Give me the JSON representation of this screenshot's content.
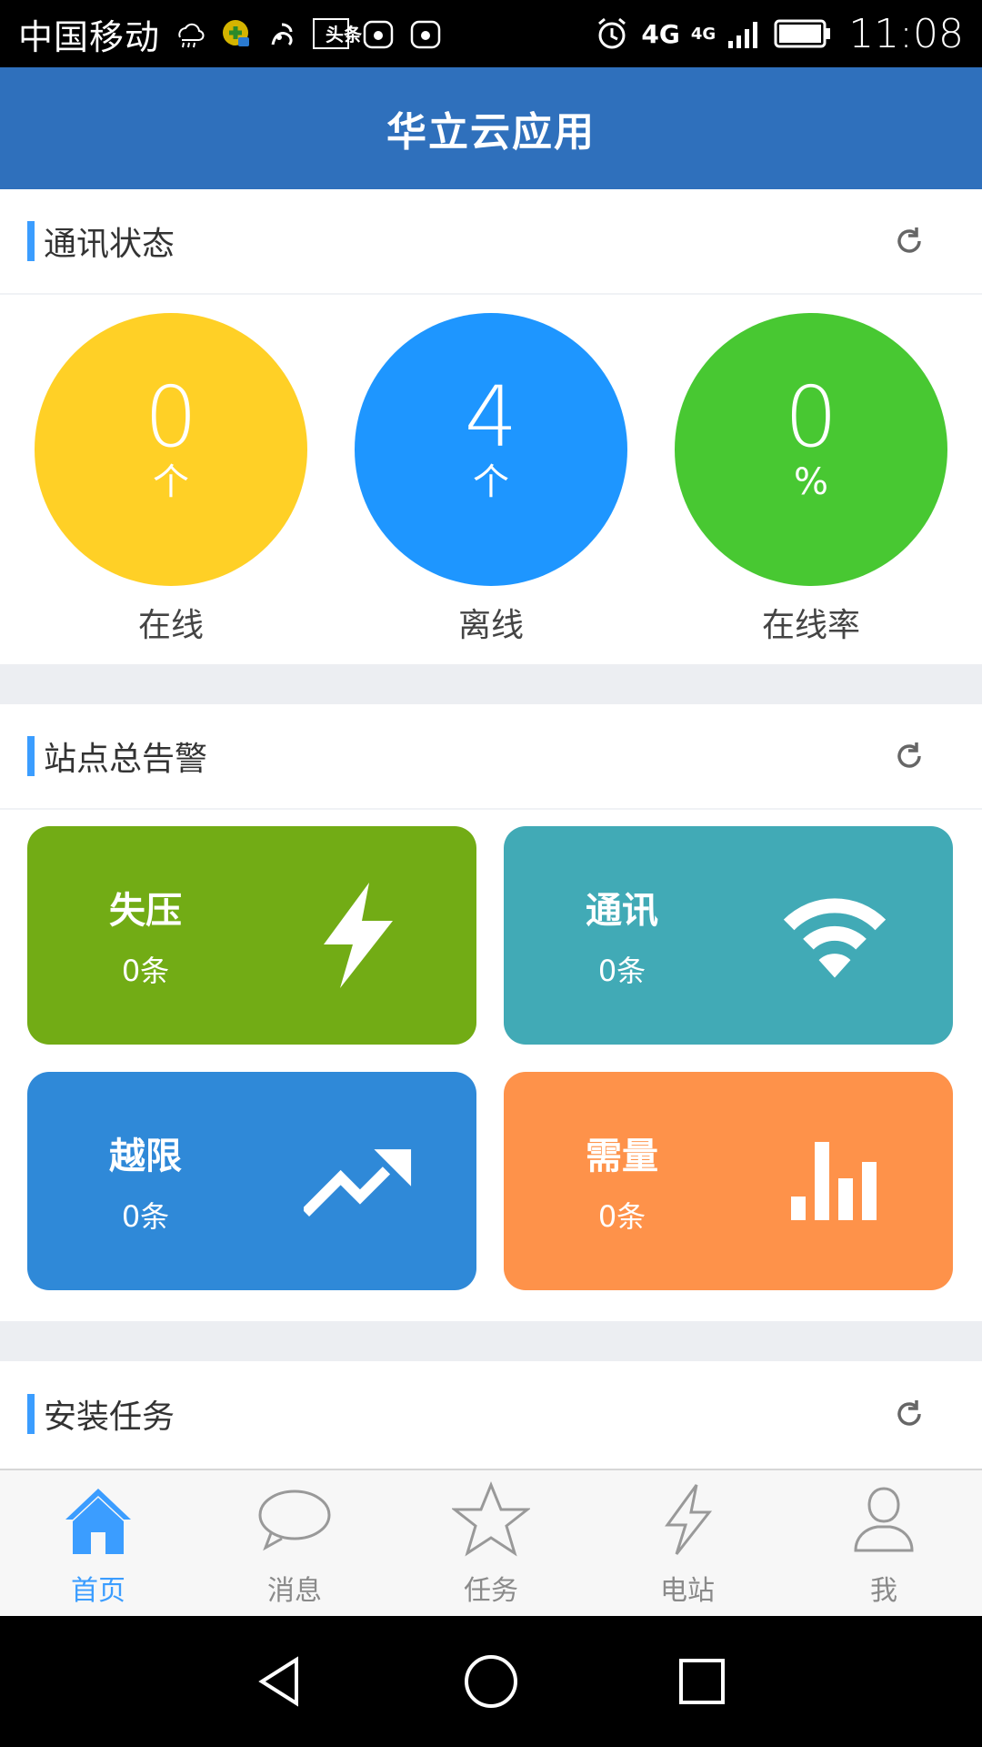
{
  "status_bar": {
    "carrier": "中国移动",
    "network_1": "4G",
    "network_2": "4G",
    "time": "11:08",
    "icons": [
      "weather-icon",
      "app-icon",
      "uc-icon",
      "toutiao-icon",
      "huawei-icon",
      "huawei-icon",
      "alarm-icon",
      "signal-icon",
      "battery-icon"
    ],
    "toutiao_label": "头条"
  },
  "app": {
    "title": "华立云应用"
  },
  "comm_section": {
    "title": "通讯状态",
    "circles": [
      {
        "value": "0",
        "unit": "个",
        "label": "在线",
        "color": "#FFD026"
      },
      {
        "value": "4",
        "unit": "个",
        "label": "离线",
        "color": "#1E96FF"
      },
      {
        "value": "0",
        "unit": "%",
        "label": "在线率",
        "color": "#48C832"
      }
    ]
  },
  "alarm_section": {
    "title": "站点总告警",
    "tiles": [
      {
        "name": "失压",
        "count": "0条",
        "color": "#72AC15",
        "icon": "lightning-icon"
      },
      {
        "name": "通讯",
        "count": "0条",
        "color": "#41AAB6",
        "icon": "wifi-icon"
      },
      {
        "name": "越限",
        "count": "0条",
        "color": "#2F89D8",
        "icon": "trend-up-icon"
      },
      {
        "name": "需量",
        "count": "0条",
        "color": "#FE924A",
        "icon": "bar-chart-icon"
      }
    ]
  },
  "install_section": {
    "title": "安装任务"
  },
  "bottom_nav": {
    "items": [
      {
        "label": "首页",
        "icon": "home-icon",
        "active": true
      },
      {
        "label": "消息",
        "icon": "message-icon",
        "active": false
      },
      {
        "label": "任务",
        "icon": "star-icon",
        "active": false
      },
      {
        "label": "电站",
        "icon": "lightning-icon",
        "active": false
      },
      {
        "label": "我",
        "icon": "user-icon",
        "active": false
      }
    ]
  },
  "colors": {
    "primary": "#2F70BC",
    "accent": "#3B9DFF"
  }
}
